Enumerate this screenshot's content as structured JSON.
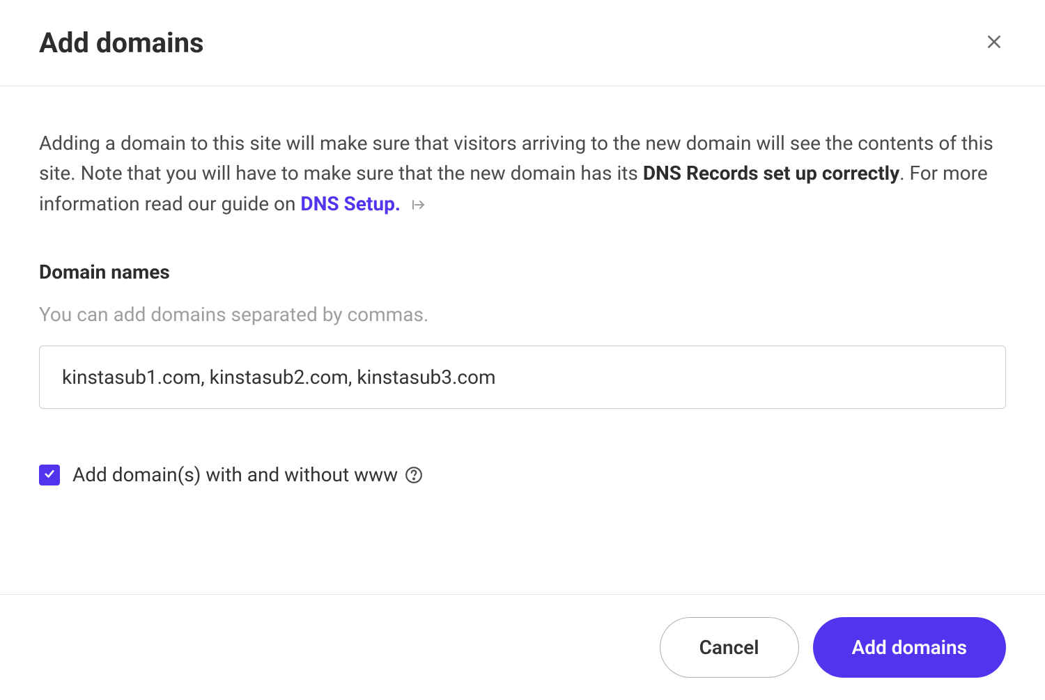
{
  "header": {
    "title": "Add domains"
  },
  "body": {
    "description_part1": "Adding a domain to this site will make sure that visitors arriving to the new domain will see the contents of this site. Note that you will have to make sure that the new domain has its ",
    "description_bold": "DNS Records set up correctly",
    "description_part2": ". For more information read our guide on ",
    "dns_link_text": "DNS Setup.",
    "field_label": "Domain names",
    "field_helper": "You can add domains separated by commas.",
    "field_value": "kinstasub1.com, kinstasub2.com, kinstasub3.com",
    "checkbox_label": "Add domain(s) with and without www"
  },
  "footer": {
    "cancel_label": "Cancel",
    "submit_label": "Add domains"
  }
}
